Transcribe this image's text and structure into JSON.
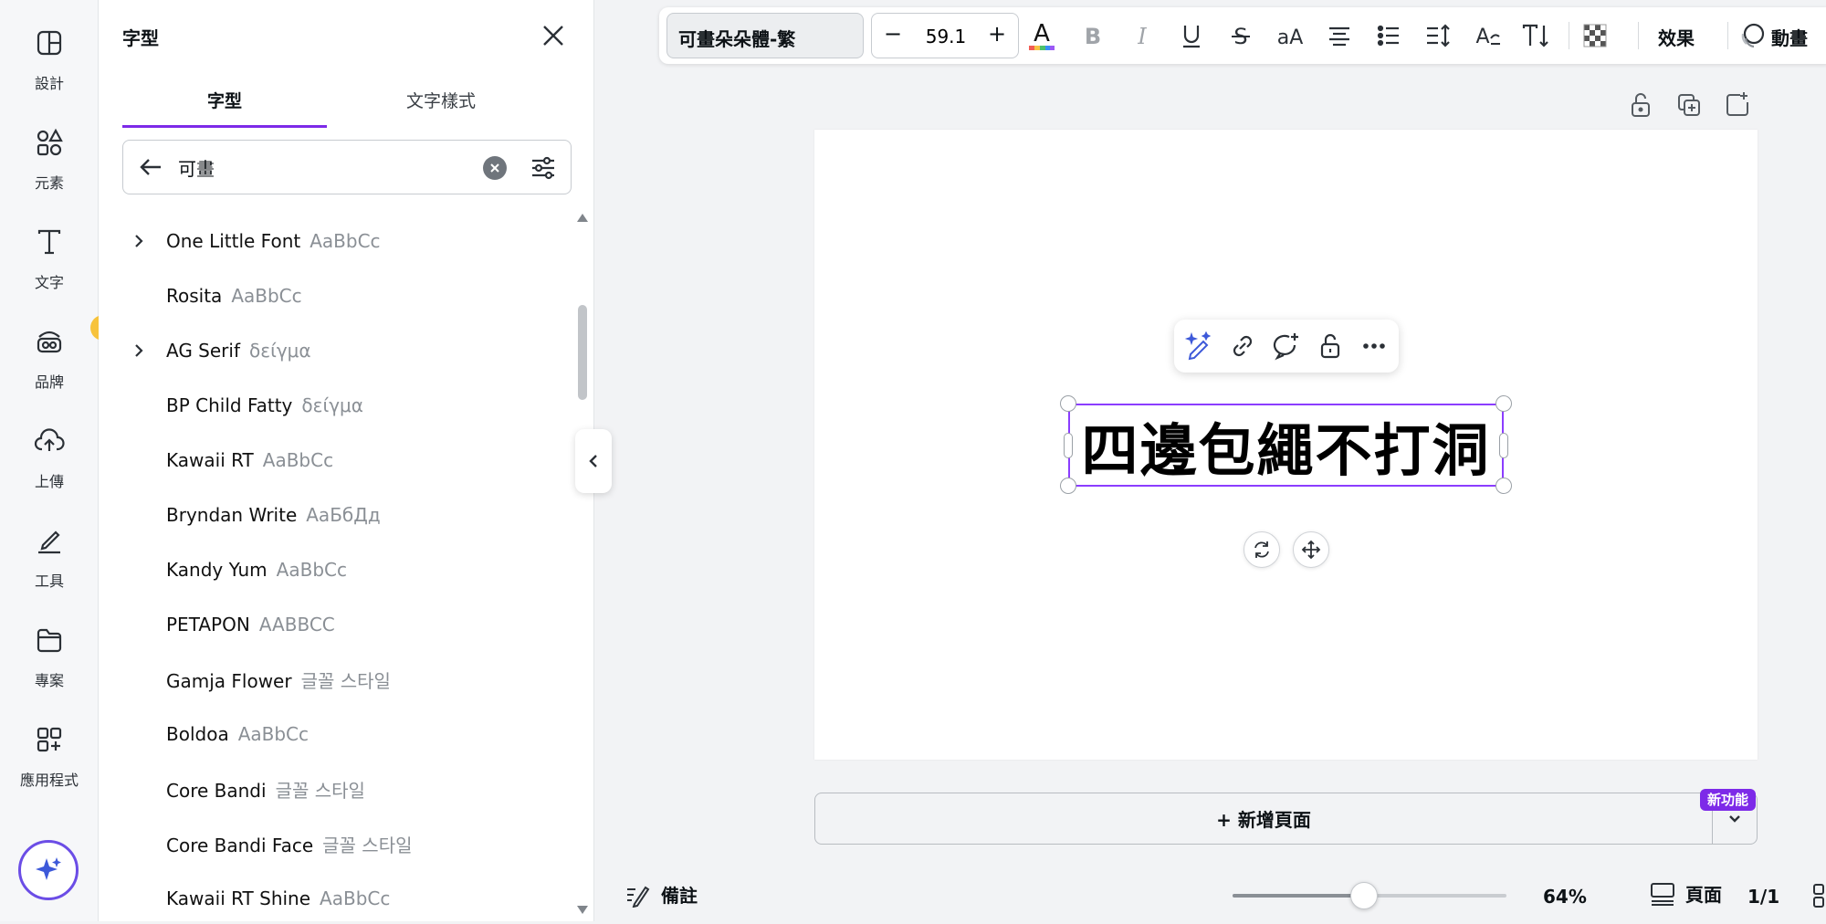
{
  "rail": {
    "items": [
      {
        "label": "設計",
        "icon": "design-icon"
      },
      {
        "label": "元素",
        "icon": "elements-icon"
      },
      {
        "label": "文字",
        "icon": "text-icon"
      },
      {
        "label": "品牌",
        "icon": "brand-icon"
      },
      {
        "label": "上傳",
        "icon": "upload-icon"
      },
      {
        "label": "工具",
        "icon": "tools-icon"
      },
      {
        "label": "專案",
        "icon": "folder-icon"
      },
      {
        "label": "應用程式",
        "icon": "apps-icon"
      }
    ]
  },
  "panel": {
    "title": "字型",
    "tabs": [
      "字型",
      "文字樣式"
    ],
    "search_value": "可畫",
    "fonts": [
      {
        "name": "One Little Font",
        "sample": "AaBbCc",
        "expandable": true
      },
      {
        "name": "Rosita",
        "sample": "AaBbCc",
        "expandable": false
      },
      {
        "name": "AG Serif",
        "sample": "δείγμα",
        "expandable": true
      },
      {
        "name": "BP Child Fatty",
        "sample": "δείγμα",
        "expandable": false
      },
      {
        "name": "Kawaii RT",
        "sample": "AaBbCc",
        "expandable": false
      },
      {
        "name": "Bryndan Write",
        "sample": "АаБбДд",
        "expandable": false
      },
      {
        "name": "Kandy Yum",
        "sample": "AaBbCc",
        "expandable": false
      },
      {
        "name": "PETAPON",
        "sample": "AABBCC",
        "expandable": false
      },
      {
        "name": "Gamja Flower",
        "sample": "글꼴 스타일",
        "expandable": false
      },
      {
        "name": "Boldoa",
        "sample": "AaBbCc",
        "expandable": false
      },
      {
        "name": "Core Bandi",
        "sample": "글꼴 스타일",
        "expandable": false
      },
      {
        "name": "Core Bandi Face",
        "sample": "글꼴 스타일",
        "expandable": false
      },
      {
        "name": "Kawaii RT Shine",
        "sample": "AaBbCc",
        "expandable": false
      }
    ]
  },
  "toolbar": {
    "font_name": "可畫朵朵體-繁",
    "font_size": "59.1",
    "minus": "−",
    "plus": "+",
    "effects_label": "效果",
    "animate_label": "動畫"
  },
  "canvas": {
    "text": "四邊包繩不打洞"
  },
  "add_page_label": "+ 新增頁面",
  "new_badge": "新功能",
  "bottom": {
    "notes_label": "備註",
    "zoom_label": "64%",
    "zoom_value": 0.48,
    "pages_label": "頁面",
    "page_count": "1/1"
  },
  "colors": {
    "accent": "#8b3dff",
    "tab_underline": "#7d2ae8"
  }
}
